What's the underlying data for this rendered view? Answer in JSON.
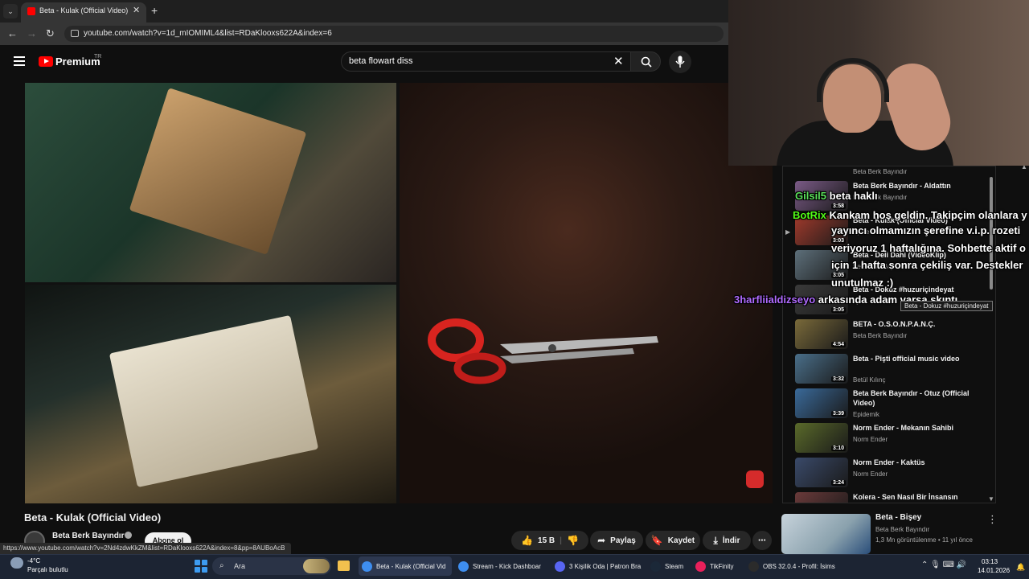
{
  "browser": {
    "tab_title": "Beta - Kulak (Official Video) - Y",
    "new_tab": "+",
    "close": "✕",
    "url": "youtube.com/watch?v=1d_mIOMIML4&list=RDaKlooxs622A&index=6"
  },
  "youtube": {
    "brand": "Premium",
    "brand_sup": "TR",
    "search_query": "beta flowart diss"
  },
  "video": {
    "title": "Beta - Kulak (Official Video)",
    "channel": "Beta Berk Bayındır",
    "subscribe_label": "Abone ol",
    "likes": "15 B",
    "share_label": "Paylaş",
    "save_label": "Kaydet",
    "download_label": "İndir"
  },
  "status_url": "https://www.youtube.com/watch?v=2Nd4zdwKkZM&list=RDaKlooxs622A&index=8&pp=8AUBoAcB",
  "playlist": {
    "partial_top_channel": "Beta Berk Bayındır",
    "items": [
      {
        "title": "Beta Berk Bayındır - Aldattın",
        "channel": "Beta Berk Bayındır",
        "duration": "3:58"
      },
      {
        "title": "Beta - Kulak (Official Video)",
        "channel": "Epidemik",
        "duration": "3:03"
      },
      {
        "title": "Beta - Deli Dahi (VideoKlip)",
        "channel": "Beta Berk Bayındır",
        "duration": "3:05"
      },
      {
        "title": "Beta - Dokuz #huzuriçindeyat",
        "channel": "Tyler",
        "duration": "3:05"
      },
      {
        "title": "BETA - O.S.O.N.P.A.N.Ç.",
        "channel": "Beta Berk Bayındır",
        "duration": "4:54"
      },
      {
        "title": "Beta - Pişti official music video",
        "channel": "Betül Kılınç",
        "duration": "3:32"
      },
      {
        "title": "Beta Berk Bayındır - Otuz (Official Video)",
        "channel": "Epidemik",
        "duration": "3:39"
      },
      {
        "title": "Norm Ender - Mekanın Sahibi",
        "channel": "Norm Ender",
        "duration": "3:10"
      },
      {
        "title": "Norm Ender - Kaktüs",
        "channel": "Norm Ender",
        "duration": "3:24"
      },
      {
        "title": "Kolera - Sen Nasıl Bir İnsansın",
        "channel": "",
        "duration": ""
      }
    ]
  },
  "tooltip": "Beta - Dokuz #huzuriçindeyat",
  "chat": [
    {
      "user": "Gilsil5",
      "text": "beta haklı",
      "color": "#5be05b"
    },
    {
      "user": "BotRix",
      "text": "Kankam hoş geldin. Takipçim olanlara y",
      "color": "#53fc18"
    },
    {
      "user": "",
      "text": "yayıncı olmamızın şerefine v.i.p. rozeti",
      "color": "#ffffff"
    },
    {
      "user": "",
      "text": "veriyoruz 1 haftalığına. Sohbette aktif o",
      "color": "#ffffff"
    },
    {
      "user": "",
      "text": "için 1 hafta sonra çekiliş var. Destekler",
      "color": "#ffffff"
    },
    {
      "user": "",
      "text": "unutulmaz :)",
      "color": "#ffffff"
    },
    {
      "user": "3harfliialdizseyo",
      "text": "arkasında adam varsa skıntı",
      "color": "#b06bff"
    }
  ],
  "related": {
    "title": "Beta - Bişey",
    "channel": "Beta Berk Bayındır",
    "meta": "1,3 Mn görüntülenme • 11 yıl önce"
  },
  "taskbar": {
    "temp": "-4°C",
    "weather": "Parçalı bulutlu",
    "search_label": "Ara",
    "apps": [
      {
        "label": "Beta - Kulak (Official Vid",
        "color": "#3e8ef0",
        "active": true
      },
      {
        "label": "Stream - Kick Dashboar",
        "color": "#3e8ef0",
        "active": false
      },
      {
        "label": "3 Kişilik Oda | Patron Bra",
        "color": "#5865f2",
        "active": false
      },
      {
        "label": "Steam",
        "color": "#1b2838",
        "active": false
      },
      {
        "label": "TikFinity",
        "color": "#e9205b",
        "active": false
      },
      {
        "label": "OBS 32.0.4 - Profil: İsims",
        "color": "#2b2b2b",
        "active": false
      }
    ],
    "time": "03:13",
    "date": "14.01.2026"
  }
}
